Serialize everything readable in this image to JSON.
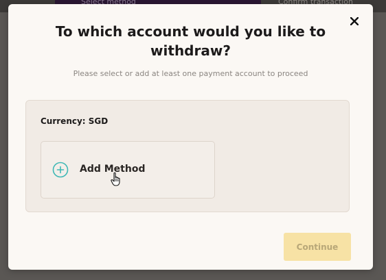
{
  "background": {
    "step_1_label": "Select method",
    "step_2_label": "Confirm transaction"
  },
  "modal": {
    "title": "To which account would you like to withdraw?",
    "subtitle": "Please select or add at least one payment account to proceed",
    "currency_label": "Currency: SGD",
    "add_method_label": "Add Method",
    "continue_label": "Continue",
    "continue_enabled": false
  },
  "icons": {
    "close": "close-icon",
    "add": "plus-circle-icon",
    "cursor": "hand-pointer-icon"
  },
  "colors": {
    "accent_teal": "#3fb8b5",
    "continue_disabled_bg": "#f7e2a5",
    "panel_bg": "#f1ebe5"
  }
}
